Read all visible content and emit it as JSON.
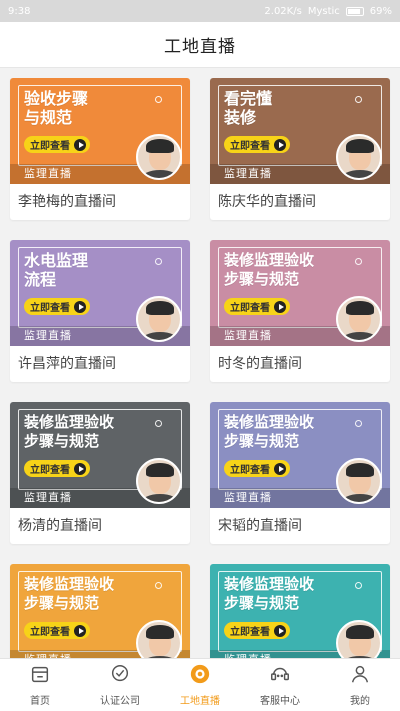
{
  "status_bar": {
    "time": "9:38",
    "net_speed": "2.02K/s",
    "carrier": "Mystic",
    "battery": "69%"
  },
  "header": {
    "title": "工地直播"
  },
  "common": {
    "watch_label": "立即查看",
    "supervise_label": "监理直播"
  },
  "cards": [
    {
      "headline": "验收步骤\n与规范",
      "caption": "李艳梅的直播间",
      "color": "#f08a3a"
    },
    {
      "headline": "看完懂\n装修",
      "caption": "陈庆华的直播间",
      "color": "#9a6a4e"
    },
    {
      "headline": "水电监理\n流程",
      "caption": "许昌萍的直播间",
      "color": "#a58fc6"
    },
    {
      "headline": "装修监理验收\n步骤与规范",
      "caption": "时冬的直播间",
      "color": "#c98da4"
    },
    {
      "headline": "装修监理验收\n步骤与规范",
      "caption": "杨清的直播间",
      "color": "#5f6366"
    },
    {
      "headline": "装修监理验收\n步骤与规范",
      "caption": "宋韬的直播间",
      "color": "#8b8fc2"
    },
    {
      "headline": "装修监理验收\n步骤与规范",
      "caption": "",
      "color": "#f0a53c"
    },
    {
      "headline": "装修监理验收\n步骤与规范",
      "caption": "",
      "color": "#3db2b0"
    }
  ],
  "nav": [
    {
      "label": "首页",
      "icon": "home-icon"
    },
    {
      "label": "认证公司",
      "icon": "verified-company-icon"
    },
    {
      "label": "工地直播",
      "icon": "live-camera-icon",
      "active": true
    },
    {
      "label": "客服中心",
      "icon": "customer-service-icon"
    },
    {
      "label": "我的",
      "icon": "profile-icon"
    }
  ],
  "colors": {
    "accent": "#f29b1a"
  }
}
